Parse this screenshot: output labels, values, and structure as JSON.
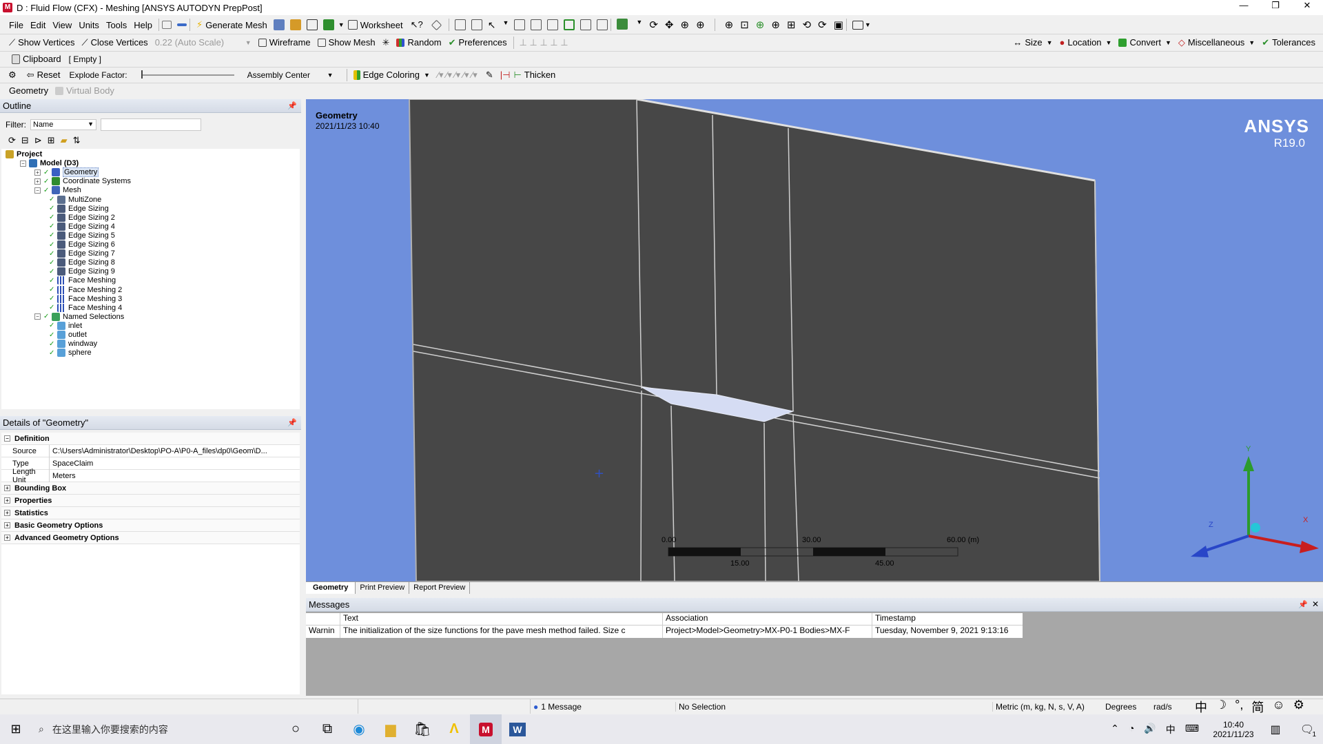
{
  "title": "D : Fluid Flow (CFX) - Meshing [ANSYS AUTODYN PrepPost]",
  "menu": [
    "File",
    "Edit",
    "View",
    "Units",
    "Tools",
    "Help"
  ],
  "toolbar1": {
    "generate_mesh": "Generate Mesh",
    "worksheet": "Worksheet"
  },
  "toolbar2": {
    "show_vertices": "Show Vertices",
    "close_vertices": "Close Vertices",
    "scale": "0.22 (Auto Scale)",
    "wireframe": "Wireframe",
    "show_mesh": "Show Mesh",
    "random": "Random",
    "preferences": "Preferences",
    "size": "Size",
    "location": "Location",
    "convert": "Convert",
    "miscellaneous": "Miscellaneous",
    "tolerances": "Tolerances"
  },
  "toolbar3": {
    "clipboard": "Clipboard",
    "empty": "[ Empty ]"
  },
  "toolbar4": {
    "reset": "Reset",
    "explode": "Explode Factor:",
    "assembly": "Assembly Center",
    "edge_coloring": "Edge Coloring",
    "thicken": "Thicken"
  },
  "toolbar5": {
    "geometry": "Geometry",
    "virtual_body": "Virtual Body"
  },
  "outline": {
    "title": "Outline",
    "filter_label": "Filter:",
    "filter_value": "Name",
    "tree": [
      {
        "label": "Project",
        "level": 0,
        "icon": "project",
        "toggle": "",
        "bold": true
      },
      {
        "label": "Model (D3)",
        "level": 1,
        "icon": "model",
        "toggle": "-",
        "bold": true
      },
      {
        "label": "Geometry",
        "level": 2,
        "icon": "geometry",
        "toggle": "+",
        "selected": true
      },
      {
        "label": "Coordinate Systems",
        "level": 2,
        "icon": "coord",
        "toggle": "+"
      },
      {
        "label": "Mesh",
        "level": 2,
        "icon": "mesh",
        "toggle": "-"
      },
      {
        "label": "MultiZone",
        "level": 3,
        "icon": "method"
      },
      {
        "label": "Edge Sizing",
        "level": 3,
        "icon": "sizing"
      },
      {
        "label": "Edge Sizing 2",
        "level": 3,
        "icon": "sizing"
      },
      {
        "label": "Edge Sizing 4",
        "level": 3,
        "icon": "sizing"
      },
      {
        "label": "Edge Sizing 5",
        "level": 3,
        "icon": "sizing"
      },
      {
        "label": "Edge Sizing 6",
        "level": 3,
        "icon": "sizing"
      },
      {
        "label": "Edge Sizing 7",
        "level": 3,
        "icon": "sizing"
      },
      {
        "label": "Edge Sizing 8",
        "level": 3,
        "icon": "sizing"
      },
      {
        "label": "Edge Sizing 9",
        "level": 3,
        "icon": "sizing"
      },
      {
        "label": "Face Meshing",
        "level": 3,
        "icon": "facemesh"
      },
      {
        "label": "Face Meshing 2",
        "level": 3,
        "icon": "facemesh"
      },
      {
        "label": "Face Meshing 3",
        "level": 3,
        "icon": "facemesh"
      },
      {
        "label": "Face Meshing 4",
        "level": 3,
        "icon": "facemesh"
      },
      {
        "label": "Named Selections",
        "level": 2,
        "icon": "named",
        "toggle": "-"
      },
      {
        "label": "inlet",
        "level": 3,
        "icon": "selection"
      },
      {
        "label": "outlet",
        "level": 3,
        "icon": "selection"
      },
      {
        "label": "windway",
        "level": 3,
        "icon": "selection"
      },
      {
        "label": "sphere",
        "level": 3,
        "icon": "selection"
      }
    ]
  },
  "details": {
    "title": "Details of \"Geometry\"",
    "definition": "Definition",
    "rows": [
      {
        "key": "Source",
        "value": "C:\\Users\\Administrator\\Desktop\\PO-A\\P0-A_files\\dp0\\Geom\\D..."
      },
      {
        "key": "Type",
        "value": "SpaceClaim"
      },
      {
        "key": "Length Unit",
        "value": "Meters"
      }
    ],
    "groups": [
      "Bounding Box",
      "Properties",
      "Statistics",
      "Basic Geometry Options",
      "Advanced Geometry Options"
    ]
  },
  "viewport": {
    "label": "Geometry",
    "datetime": "2021/11/23 10:40",
    "brand": "ANSYS",
    "version": "R19.0",
    "scale_top": [
      "0.00",
      "30.00",
      "60.00 (m)"
    ],
    "scale_bottom": [
      "15.00",
      "45.00"
    ],
    "axis_x": "X",
    "axis_y": "Y",
    "axis_z": "Z",
    "tabs": [
      "Geometry",
      "Print Preview",
      "Report Preview"
    ]
  },
  "messages": {
    "title": "Messages",
    "headers": [
      "Text",
      "Association",
      "Timestamp"
    ],
    "row": {
      "type": "Warnin",
      "text": "The initialization of the size functions for the pave mesh method failed. Size c",
      "assoc": "Project>Model>Geometry>MX-P0-1 Bodies>MX-F",
      "time": "Tuesday, November 9, 2021 9:13:16"
    }
  },
  "status": {
    "messages": "1 Message",
    "selection": "No Selection",
    "units": "Metric (m, kg, N, s, V, A)",
    "degrees": "Degrees",
    "rads": "rad/s"
  },
  "ime": [
    "中",
    "☽",
    "°,",
    "简",
    "☺",
    "⚙"
  ],
  "taskbar": {
    "search": "在这里输入你要搜索的内容",
    "time": "10:40",
    "date": "2021/11/23",
    "ime": "中",
    "notif": "1"
  },
  "colors": {
    "viewport_bg": "#6e8fdc",
    "body": "#474747",
    "highlight": "#d5dcf3",
    "panel_header": "#dde3ed"
  }
}
